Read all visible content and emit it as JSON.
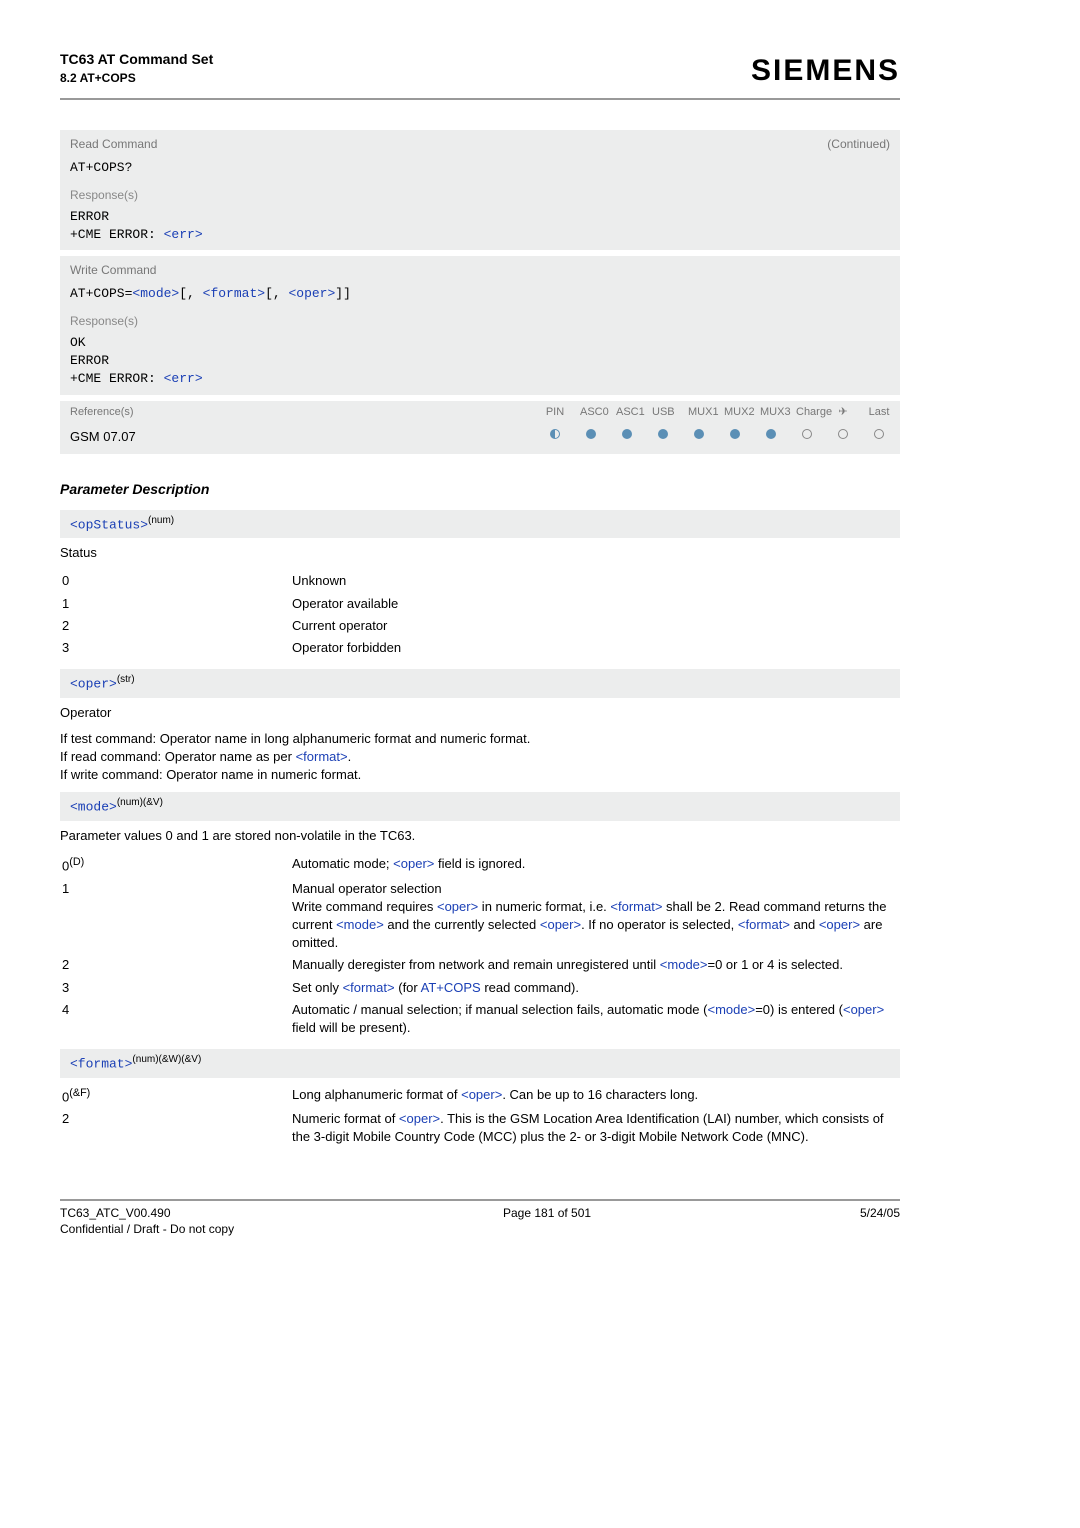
{
  "header": {
    "title": "TC63 AT Command Set",
    "sub": "8.2 AT+COPS",
    "brand": "SIEMENS"
  },
  "readCmd": {
    "label": "Read Command",
    "continued": "(Continued)",
    "cmd": "AT+COPS?",
    "respLabel": "Response(s)",
    "line1": "ERROR",
    "line2a": "+CME ERROR: ",
    "line2b": "<err>"
  },
  "writeCmd": {
    "label": "Write Command",
    "prefix": "AT+COPS=",
    "p1": "<mode>",
    "sep1": "[, ",
    "p2": "<format>",
    "sep2": "[, ",
    "p3": "<oper>",
    "sep3": "]]",
    "respLabel": "Response(s)",
    "l1": "OK",
    "l2": "ERROR",
    "l3a": "+CME ERROR: ",
    "l3b": "<err>"
  },
  "ref": {
    "label": "Reference(s)",
    "cols": [
      "PIN",
      "ASC0",
      "ASC1",
      "USB",
      "MUX1",
      "MUX2",
      "MUX3",
      "Charge",
      "✈",
      "Last"
    ],
    "value": "GSM 07.07"
  },
  "paramDescTitle": "Parameter Description",
  "opStatus": {
    "tag": "<opStatus>",
    "sup": "(num)",
    "title": "Status",
    "rows": [
      {
        "k": "0",
        "v": "Unknown"
      },
      {
        "k": "1",
        "v": "Operator available"
      },
      {
        "k": "2",
        "v": "Current operator"
      },
      {
        "k": "3",
        "v": "Operator forbidden"
      }
    ]
  },
  "oper": {
    "tag": "<oper>",
    "sup": "(str)",
    "title": "Operator",
    "l1": "If test command: Operator name in long alphanumeric format and numeric format.",
    "l2a": "If read command: Operator name as per ",
    "l2b": "<format>",
    "l2c": ".",
    "l3": "If write command: Operator name in numeric format."
  },
  "mode": {
    "tag": "<mode>",
    "sup": "(num)(&V)",
    "intro": "Parameter values 0 and 1 are stored non-volatile in the TC63.",
    "rows": {
      "r0k": "0",
      "r0sup": "(D)",
      "r0a": "Automatic mode; ",
      "r0b": "<oper>",
      "r0c": " field is ignored.",
      "r1k": "1",
      "r1l1": "Manual operator selection",
      "r1l2a": "Write command requires ",
      "r1l2b": "<oper>",
      "r1l2c": " in numeric format, i.e. ",
      "r1l2d": "<format>",
      "r1l2e": " shall be 2.",
      "r1l3a": "Read command returns the current ",
      "r1l3b": "<mode>",
      "r1l3c": " and the currently selected ",
      "r1l3d": "<oper>",
      "r1l3e": ". If no operator is selected, ",
      "r1l3f": "<format>",
      "r1l3g": " and ",
      "r1l3h": "<oper>",
      "r1l3i": " are omitted.",
      "r2k": "2",
      "r2a": "Manually deregister from network and remain unregistered until ",
      "r2b": "<mode>",
      "r2c": "=0 or 1 or 4 is selected.",
      "r3k": "3",
      "r3a": "Set only ",
      "r3b": "<format>",
      "r3c": " (for ",
      "r3d": "AT+COPS",
      "r3e": " read command).",
      "r4k": "4",
      "r4a": "Automatic / manual selection; if manual selection fails, automatic mode (",
      "r4b": "<mode>",
      "r4c": "=0) is entered (",
      "r4d": "<oper>",
      "r4e": " field will be present)."
    }
  },
  "format": {
    "tag": "<format>",
    "sup": "(num)(&W)(&V)",
    "r0k": "0",
    "r0sup": "(&F)",
    "r0a": "Long alphanumeric format of ",
    "r0b": "<oper>",
    "r0c": ". Can be up to 16 characters long.",
    "r2k": "2",
    "r2a": "Numeric format of ",
    "r2b": "<oper>",
    "r2c": ". This is the GSM Location Area Identification (LAI) number, which consists of the 3-digit Mobile Country Code (MCC) plus the 2- or 3-digit Mobile Network Code (MNC)."
  },
  "footer": {
    "left1": "TC63_ATC_V00.490",
    "left2": "Confidential / Draft - Do not copy",
    "center": "Page 181 of 501",
    "right": "5/24/05"
  }
}
